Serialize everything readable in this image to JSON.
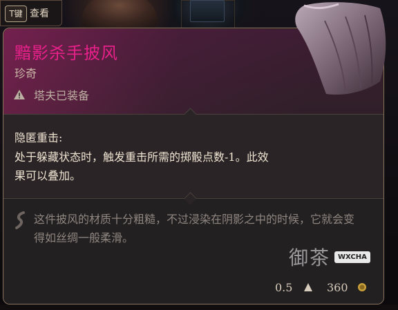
{
  "hud": {
    "key_cap": "T键",
    "key_action": "查看"
  },
  "tooltip": {
    "item_name": "黯影杀手披风",
    "rarity": "珍奇",
    "equipped_by": "塔夫已装备",
    "passive": {
      "title": "隐匿重击:",
      "description": "处于躲藏状态时，触发重击所需的掷骰点数-1。此效果可以叠加。"
    },
    "lore": "这件披风的材质十分粗糙，不过浸染在阴影之中的时候，它就会变得如丝绸一般柔滑。",
    "weight": "0.5",
    "price": "360"
  },
  "watermark": {
    "text": "御茶",
    "tag": "WXCHA"
  },
  "colors": {
    "rarity_name": "#e8208a",
    "panel_border": "#8a7560",
    "body_text": "#efe4d2",
    "lore_text": "#8f8680"
  },
  "icons": {
    "equipped_warning": "warning-triangle-icon",
    "lore": "quill-icon",
    "weight": "weight-icon",
    "gold": "coin-icon",
    "item": "cloak-icon"
  }
}
